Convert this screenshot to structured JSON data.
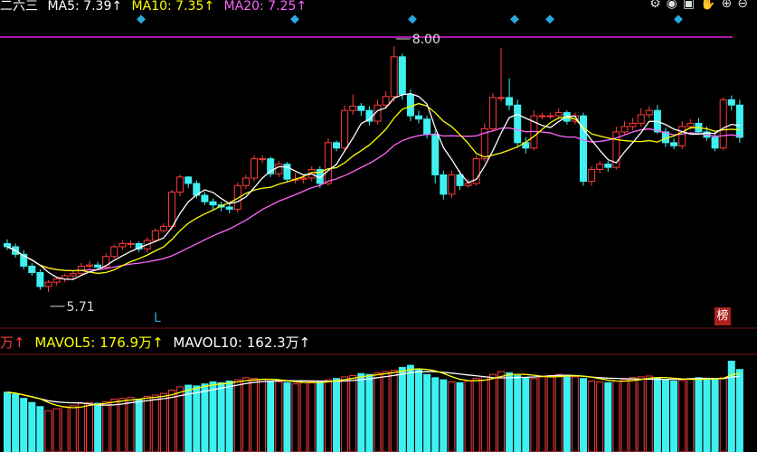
{
  "header": {
    "name": "二六三",
    "ma5": "MA5: 7.39↑",
    "ma10": "MA10: 7.35↑",
    "ma20": "MA20: 7.25↑"
  },
  "toolbar": {
    "icons": [
      "gear-icon",
      "eye-icon",
      "trash-icon",
      "hand-icon",
      "plus-icon",
      "minus-icon"
    ]
  },
  "volume_header": {
    "vol": "万↑",
    "mavol5": "MAVOL5: 176.9万↑",
    "mavol10": "MAVOL10: 162.3万↑"
  },
  "badge": "榜",
  "chart_data": [
    {
      "type": "candlestick",
      "title": "",
      "annotations": [
        {
          "label": "8.00",
          "kind": "high"
        },
        {
          "label": "5.71",
          "kind": "low"
        },
        {
          "label": "L",
          "kind": "marker"
        }
      ],
      "colors": {
        "up": "#ff3b3b",
        "down": "#3ff0f0",
        "ma5": "#ffffff",
        "ma10": "#ffff00",
        "ma20": "#ff66ff",
        "limit_line": "#e020e0"
      },
      "open": [
        6.16,
        6.13,
        6.06,
        5.95,
        5.89,
        5.76,
        5.8,
        5.83,
        5.86,
        5.88,
        5.95,
        5.96,
        5.94,
        6.04,
        6.13,
        6.16,
        6.16,
        6.11,
        6.19,
        6.28,
        6.32,
        6.64,
        6.78,
        6.72,
        6.61,
        6.55,
        6.52,
        6.5,
        6.48,
        6.7,
        6.77,
        6.95,
        6.95,
        6.81,
        6.9,
        6.76,
        6.76,
        6.77,
        6.85,
        6.72,
        7.1,
        7.05,
        7.4,
        7.44,
        7.4,
        7.3,
        7.45,
        7.53,
        7.9,
        7.55,
        7.35,
        7.32,
        7.18,
        6.8,
        6.62,
        6.8,
        6.7,
        6.72,
        6.95,
        7.23,
        7.52,
        7.52,
        7.45,
        7.1,
        7.05,
        7.35,
        7.35,
        7.35,
        7.38,
        7.3,
        7.35,
        6.74,
        6.85,
        6.9,
        6.87,
        7.2,
        7.25,
        7.28,
        7.36,
        7.4,
        7.2,
        7.1,
        7.07,
        7.25,
        7.28,
        7.2,
        7.15,
        7.05,
        7.5,
        7.45
      ],
      "close": [
        6.13,
        6.06,
        5.95,
        5.89,
        5.76,
        5.8,
        5.83,
        5.86,
        5.88,
        5.95,
        5.96,
        5.94,
        6.04,
        6.13,
        6.16,
        6.16,
        6.11,
        6.19,
        6.28,
        6.32,
        6.64,
        6.78,
        6.72,
        6.61,
        6.55,
        6.52,
        6.5,
        6.48,
        6.7,
        6.77,
        6.95,
        6.95,
        6.81,
        6.9,
        6.76,
        6.76,
        6.77,
        6.85,
        6.72,
        7.1,
        7.05,
        7.4,
        7.44,
        7.4,
        7.3,
        7.45,
        7.53,
        7.9,
        7.55,
        7.35,
        7.32,
        7.18,
        6.8,
        6.62,
        6.8,
        6.7,
        6.72,
        6.95,
        7.23,
        7.52,
        7.52,
        7.45,
        7.1,
        7.05,
        7.35,
        7.35,
        7.35,
        7.38,
        7.3,
        7.35,
        6.74,
        6.85,
        6.9,
        6.87,
        7.2,
        7.25,
        7.28,
        7.36,
        7.4,
        7.2,
        7.1,
        7.07,
        7.25,
        7.28,
        7.2,
        7.15,
        7.05,
        7.5,
        7.45,
        7.15
      ],
      "high": [
        6.2,
        6.16,
        6.1,
        5.98,
        5.92,
        5.82,
        5.85,
        5.88,
        5.9,
        5.98,
        6.0,
        5.99,
        6.07,
        6.15,
        6.19,
        6.19,
        6.18,
        6.22,
        6.3,
        6.35,
        6.66,
        6.8,
        6.79,
        6.75,
        6.64,
        6.58,
        6.55,
        6.54,
        6.73,
        6.8,
        6.98,
        6.98,
        6.97,
        6.93,
        6.92,
        6.82,
        6.8,
        6.88,
        6.88,
        7.14,
        7.12,
        7.45,
        7.55,
        7.47,
        7.44,
        7.5,
        7.58,
        8.0,
        7.93,
        7.6,
        7.4,
        7.35,
        7.22,
        6.84,
        6.84,
        6.84,
        6.76,
        6.98,
        7.28,
        7.56,
        7.98,
        7.7,
        7.5,
        7.15,
        7.4,
        7.38,
        7.38,
        7.42,
        7.4,
        7.38,
        7.38,
        6.88,
        6.93,
        6.93,
        7.25,
        7.3,
        7.33,
        7.42,
        7.44,
        7.45,
        7.24,
        7.14,
        7.3,
        7.32,
        7.33,
        7.25,
        7.2,
        7.52,
        7.54,
        7.5
      ],
      "low": [
        6.1,
        6.03,
        5.92,
        5.86,
        5.73,
        5.71,
        5.77,
        5.8,
        5.83,
        5.86,
        5.91,
        5.91,
        5.92,
        6.02,
        6.1,
        6.12,
        6.08,
        6.08,
        6.17,
        6.26,
        6.3,
        6.6,
        6.68,
        6.58,
        6.52,
        6.48,
        6.46,
        6.44,
        6.45,
        6.67,
        6.74,
        6.91,
        6.78,
        6.78,
        6.73,
        6.72,
        6.72,
        6.74,
        6.68,
        6.7,
        7.02,
        7.02,
        7.36,
        7.35,
        7.26,
        7.27,
        7.43,
        7.48,
        7.5,
        7.3,
        7.28,
        7.14,
        6.72,
        6.57,
        6.58,
        6.66,
        6.68,
        6.7,
        6.92,
        7.2,
        7.48,
        7.4,
        7.05,
        7.0,
        7.03,
        7.32,
        7.32,
        7.33,
        7.27,
        7.27,
        6.7,
        6.7,
        6.82,
        6.83,
        6.85,
        7.17,
        7.22,
        7.25,
        7.33,
        7.18,
        7.06,
        7.04,
        7.04,
        7.22,
        7.18,
        7.12,
        7.02,
        7.03,
        7.4,
        7.1
      ]
    },
    {
      "type": "bar",
      "title": "",
      "ylabel": "万",
      "values": [
        145,
        140,
        130,
        120,
        110,
        100,
        105,
        110,
        112,
        118,
        120,
        118,
        122,
        128,
        130,
        132,
        128,
        135,
        138,
        142,
        150,
        158,
        162,
        160,
        165,
        170,
        168,
        172,
        175,
        180,
        178,
        176,
        172,
        170,
        168,
        165,
        168,
        170,
        172,
        175,
        178,
        182,
        185,
        190,
        188,
        192,
        195,
        198,
        205,
        210,
        200,
        188,
        180,
        175,
        170,
        168,
        172,
        178,
        182,
        188,
        195,
        192,
        185,
        180,
        178,
        182,
        185,
        188,
        186,
        182,
        178,
        172,
        170,
        168,
        172,
        176,
        180,
        182,
        184,
        180,
        176,
        172,
        174,
        178,
        180,
        178,
        176,
        180,
        220,
        200
      ],
      "series": [
        {
          "name": "MAVOL5",
          "color": "#ffff00"
        },
        {
          "name": "MAVOL10",
          "color": "#ffffff"
        }
      ]
    }
  ]
}
